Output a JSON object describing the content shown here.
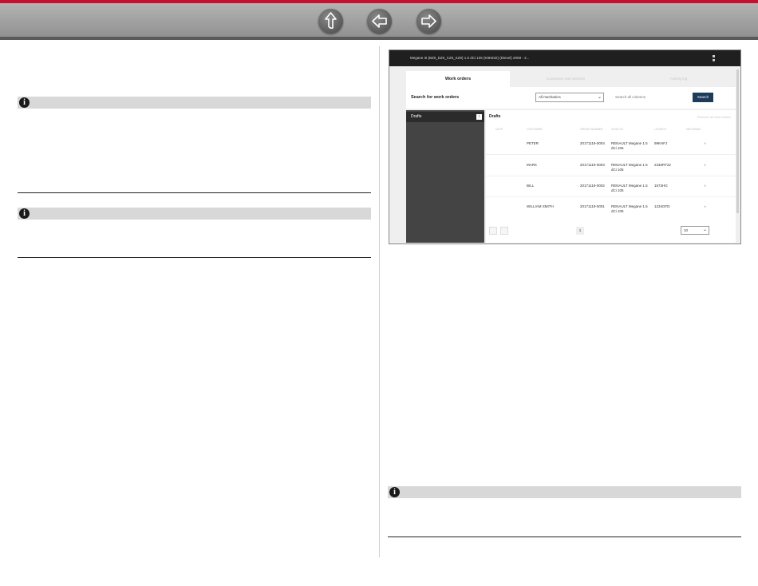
{
  "header": {
    "nav": [
      {
        "name": "up",
        "icon": "up-arrow-icon"
      },
      {
        "name": "back",
        "icon": "left-arrow-icon"
      },
      {
        "name": "forward",
        "icon": "right-arrow-icon"
      }
    ],
    "accent_color": "#c8102e"
  },
  "notes": [
    {
      "icon": "info-icon",
      "glyph": "i"
    },
    {
      "icon": "info-icon",
      "glyph": "i"
    },
    {
      "icon": "info-icon",
      "glyph": "i"
    }
  ],
  "app": {
    "title": "Megane III (BZ0_DZ0_CZ0_KZ0) 1.5 dCi 105 (K9K832) (Diesel) 2008 - 2...",
    "tabs": [
      "Work orders",
      "Customers and vehicles",
      "Activity log"
    ],
    "search_label": "Search for work orders",
    "mechanic_select": "All mechanics",
    "search_placeholder": "Search all columns",
    "search_button": "Search",
    "sidebar_item": "Drafts",
    "sidebar_item_chevron": "›",
    "main_title": "Drafts",
    "main_link": "Remove all work orders",
    "columns": [
      "DATE",
      "CUSTOMER",
      "ORDER NUMBER",
      "VEHICLE",
      "LICENCE",
      "MECHANIC"
    ],
    "rows": [
      {
        "customer": "PETER",
        "order": "20171119-0004",
        "vehicle_1": "RENAULT Megane 1.5",
        "vehicle_2": "dCi 105",
        "licence": "99KHFJ",
        "chevron": "›"
      },
      {
        "customer": "MARK",
        "order": "20171119-0003",
        "vehicle_1": "RENAULT Megane 1.5",
        "vehicle_2": "dCi 105",
        "licence": "2346RT22",
        "chevron": "›"
      },
      {
        "customer": "BILL",
        "order": "20171119-0002",
        "vehicle_1": "RENAULT Megane 1.5",
        "vehicle_2": "dCi 105",
        "licence": "1573HG",
        "chevron": "›"
      },
      {
        "customer": "WILLIAM SMITH",
        "order": "20171119-0001",
        "vehicle_1": "RENAULT Megane 1.5",
        "vehicle_2": "dCi 105",
        "licence": "1234GFD",
        "chevron": "›"
      }
    ],
    "page_number": "1",
    "page_size": "10",
    "chevron_down": "⌄"
  }
}
